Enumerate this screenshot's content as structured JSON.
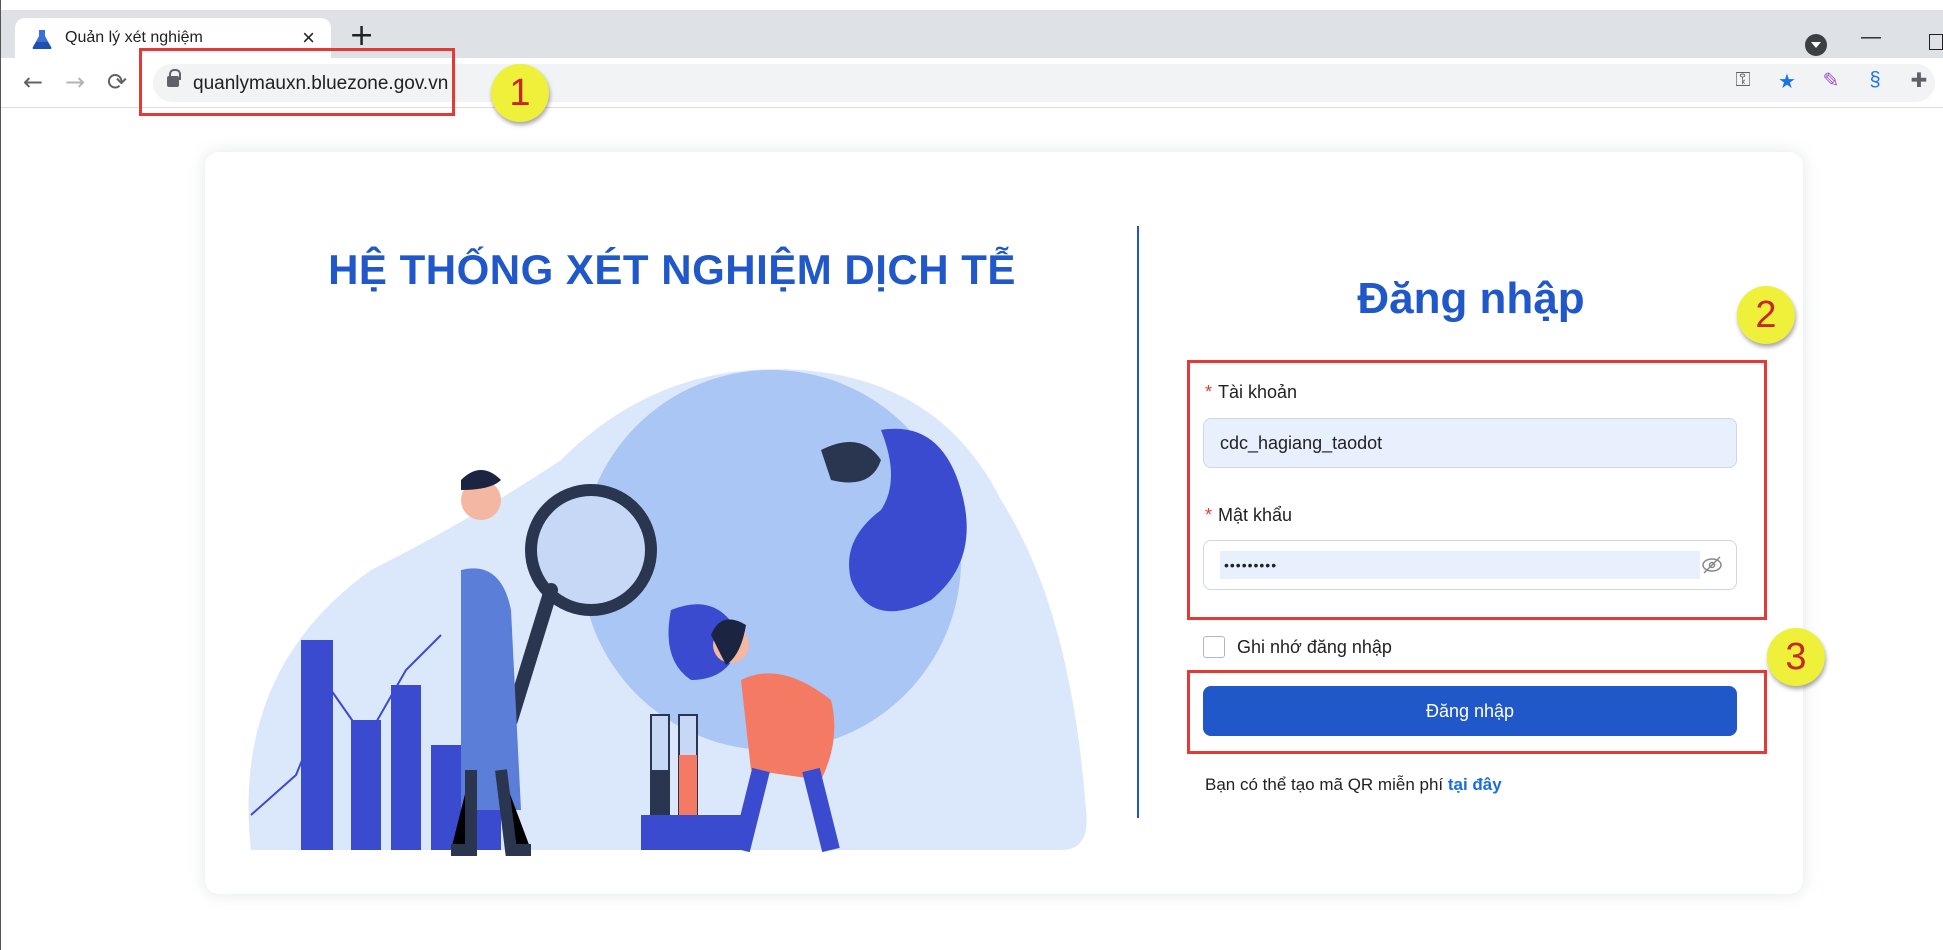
{
  "browser": {
    "tab_title": "Quản lý xét nghiệm",
    "tab_close": "×",
    "new_tab": "+",
    "url": "quanlymauxn.bluezone.gov.vn",
    "window_min": "—"
  },
  "annotations": [
    "1",
    "2",
    "3"
  ],
  "left_panel": {
    "title": "HỆ THỐNG XÉT NGHIỆM DỊCH TỄ"
  },
  "login": {
    "title": "Đăng nhập",
    "account_label": "Tài khoản",
    "account_value": "cdc_hagiang_taodot",
    "password_label": "Mật khẩu",
    "password_mask": "•••••••••",
    "required_mark": "*",
    "remember_label": "Ghi nhớ đăng nhập",
    "submit_label": "Đăng nhập",
    "qr_text": "Bạn có thể tạo mã QR miễn phí",
    "qr_link": "tại đây"
  },
  "colors": {
    "primary": "#2058c9",
    "annotation_box": "#e53935",
    "annotation_badge": "#eef03a"
  }
}
